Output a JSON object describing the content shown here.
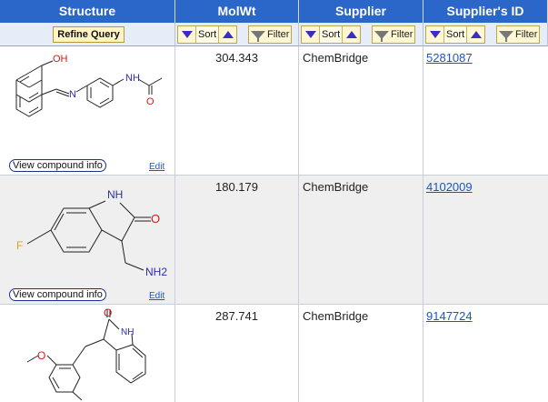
{
  "columns": [
    {
      "key": "structure",
      "title": "Structure"
    },
    {
      "key": "molwt",
      "title": "MolWt"
    },
    {
      "key": "supplier",
      "title": "Supplier"
    },
    {
      "key": "supplier_id",
      "title": "Supplier's ID"
    }
  ],
  "controls": {
    "refine_label": "Refine Query",
    "sort_label": "Sort",
    "filter_label": "Filter"
  },
  "rows": [
    {
      "molwt": "304.343",
      "supplier": "ChemBridge",
      "supplier_id": "5281087",
      "view_label": "View compound info",
      "edit_label": "Edit",
      "atoms": [
        "OH",
        "N",
        "H",
        "N",
        "O"
      ]
    },
    {
      "molwt": "180.179",
      "supplier": "ChemBridge",
      "supplier_id": "4102009",
      "view_label": "View compound info",
      "edit_label": "Edit",
      "atoms": [
        "NH",
        "O",
        "F",
        "NH2"
      ]
    },
    {
      "molwt": "287.741",
      "supplier": "ChemBridge",
      "supplier_id": "9147724",
      "atoms": [
        "O",
        "NH",
        "O"
      ]
    }
  ],
  "colors": {
    "header_bg": "#2b66c9",
    "control_bg": "#e6edf8",
    "alt_row_bg": "#efefef",
    "link": "#1a55c8",
    "n_atom": "#2b2bb5",
    "o_atom": "#d41a1a",
    "f_atom": "#e0a020"
  }
}
